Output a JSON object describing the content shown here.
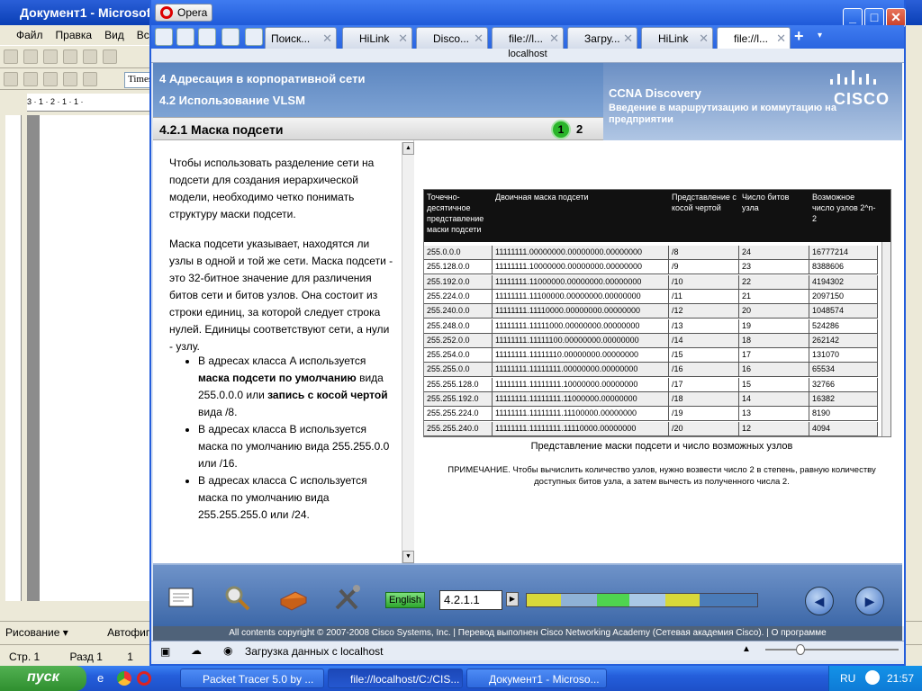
{
  "word": {
    "title": "Документ1 - Microsoft",
    "menu": [
      "Файл",
      "Правка",
      "Вид",
      "Вст"
    ],
    "font_box": "Times",
    "ruler": "3 · 1 · 2 · 1 · 1 ·",
    "drawing_label": "Рисование ▾",
    "autoshapes_label": "Автофигур",
    "status_page": "Стр. 1",
    "status_section": "Разд 1",
    "status_page_num": "1"
  },
  "opera": {
    "menu_button": "Opera",
    "address": "localhost",
    "tabs": [
      {
        "label": "Поиск..."
      },
      {
        "label": "HiLink"
      },
      {
        "label": "Disco..."
      },
      {
        "label": "file://l..."
      },
      {
        "label": "Загру..."
      },
      {
        "label": "HiLink"
      },
      {
        "label": "file://l..."
      }
    ],
    "status_text": "Загрузка данных с localhost"
  },
  "course": {
    "header_line1": "4 Адресация в корпоративной сети",
    "header_line2": "4.2 Использование VLSM",
    "brand_title": "CCNA Discovery",
    "brand_subtitle": "Введение в маршрутизацию и коммутацию на предприятии",
    "cisco_logo": "CISCO",
    "section_title": "4.2.1 Маска подсети",
    "page_current": "1",
    "page_next": "2",
    "para1": "Чтобы использовать разделение сети на подсети для создания иерархической модели, необходимо четко понимать структуру маски подсети.",
    "para2": "Маска подсети указывает, находятся ли узлы в одной и той же сети. Маска подсети - это 32-битное значение для различения битов сети и битов узлов. Она состоит из строки единиц, за которой следует строка нулей. Единицы соответствуют сети, а нули - узлу.",
    "bullet1_a": "В адресах класса A используется ",
    "bullet1_b": "маска подсети по умолчанию",
    "bullet1_c": " вида 255.0.0.0 или ",
    "bullet1_d": "запись с косой чертой",
    "bullet1_e": " вида /8.",
    "bullet2": "В адресах класса B используется маска по умолчанию вида 255.255.0.0 или /16.",
    "bullet3": "В адресах класса C используется маска по умолчанию вида 255.255.255.0 или /24.",
    "table_caption": "Представление маски подсети и число возможных узлов",
    "table_note": "ПРИМЕЧАНИЕ. Чтобы вычислить количество узлов, нужно возвести число 2 в степень, равную количеству доступных битов узла, а затем вычесть из полученного числа 2.",
    "table_headers": [
      "Точечно-десятичное представление маски подсети",
      "Двоичная маска подсети",
      "Представление с косой чертой",
      "Число битов узла",
      "Возможное число узлов 2^n-2"
    ],
    "table_rows": [
      [
        "255.0.0.0",
        "11111111.00000000.00000000.00000000",
        "/8",
        "24",
        "16777214"
      ],
      [
        "255.128.0.0",
        "11111111.10000000.00000000.00000000",
        "/9",
        "23",
        "8388606"
      ],
      [
        "255.192.0.0",
        "11111111.11000000.00000000.00000000",
        "/10",
        "22",
        "4194302"
      ],
      [
        "255.224.0.0",
        "11111111.11100000.00000000.00000000",
        "/11",
        "21",
        "2097150"
      ],
      [
        "255.240.0.0",
        "11111111.11110000.00000000.00000000",
        "/12",
        "20",
        "1048574"
      ],
      [
        "255.248.0.0",
        "11111111.11111000.00000000.00000000",
        "/13",
        "19",
        "524286"
      ],
      [
        "255.252.0.0",
        "11111111.11111100.00000000.00000000",
        "/14",
        "18",
        "262142"
      ],
      [
        "255.254.0.0",
        "11111111.11111110.00000000.00000000",
        "/15",
        "17",
        "131070"
      ],
      [
        "255.255.0.0",
        "11111111.11111111.00000000.00000000",
        "/16",
        "16",
        "65534"
      ],
      [
        "255.255.128.0",
        "11111111.11111111.10000000.00000000",
        "/17",
        "15",
        "32766"
      ],
      [
        "255.255.192.0",
        "11111111.11111111.11000000.00000000",
        "/18",
        "14",
        "16382"
      ],
      [
        "255.255.224.0",
        "11111111.11111111.11100000.00000000",
        "/19",
        "13",
        "8190"
      ],
      [
        "255.255.240.0",
        "11111111.11111111.11110000.00000000",
        "/20",
        "12",
        "4094"
      ]
    ],
    "language_button": "English",
    "page_input": "4.2.1.1",
    "footer_text": "All contents copyright © 2007-2008 Cisco Systems, Inc. | Перевод выполнен Cisco Networking Academy (Сетевая академия Cisco). | ",
    "footer_link": "О программе",
    "progress_colors": [
      "#d8d83a",
      "#8fb2d6",
      "#4fd44f",
      "#a9c8e6",
      "#d8d83a",
      "#4a7bb8"
    ]
  },
  "taskbar": {
    "start": "пуск",
    "tasks": [
      "Packet Tracer 5.0 by ...",
      "file://localhost/C:/CIS...",
      "Документ1 - Microso..."
    ],
    "lang": "RU",
    "clock": "21:57"
  }
}
